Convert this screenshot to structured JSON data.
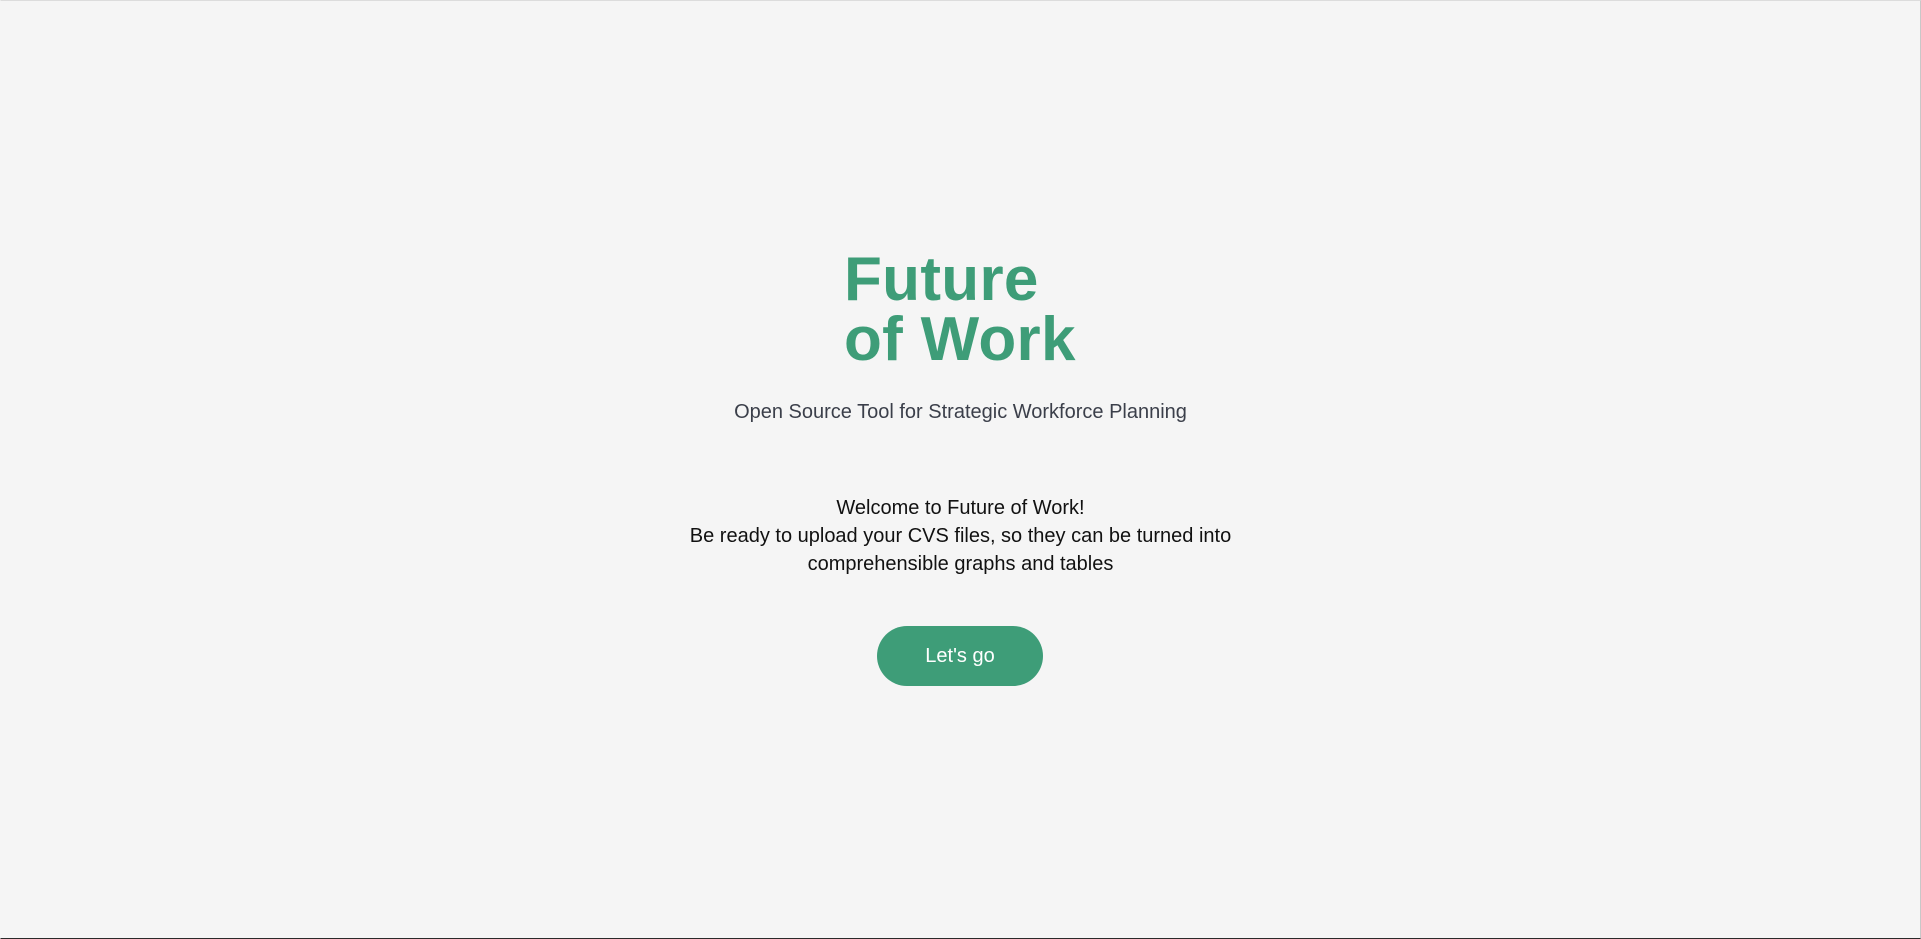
{
  "hero": {
    "title_line1": "Future",
    "title_line2": "of Work",
    "subtitle": "Open Source Tool for Strategic Workforce Planning"
  },
  "welcome": {
    "line1": "Welcome to Future of Work!",
    "line2": "Be ready to upload your CVS files, so they can be turned into",
    "line3": "comprehensible graphs and tables"
  },
  "cta": {
    "label": "Let's go"
  },
  "colors": {
    "brand": "#3e9d78",
    "background": "#f5f5f5",
    "subtitle_text": "#3b3f4a",
    "body_text": "#111111"
  }
}
